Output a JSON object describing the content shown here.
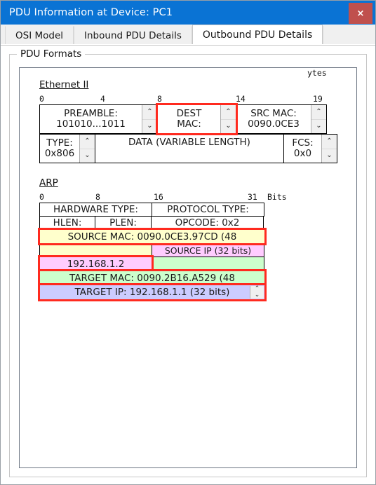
{
  "window": {
    "title": "PDU Information at Device: PC1",
    "close_label": "×",
    "titlebar_color": "#0a73d4",
    "close_color": "#c0504d"
  },
  "tabs": [
    {
      "label": "OSI Model",
      "active": false
    },
    {
      "label": "Inbound PDU Details",
      "active": false
    },
    {
      "label": "Outbound PDU Details",
      "active": true
    }
  ],
  "groupbox": {
    "title": "PDU Formats"
  },
  "ethernet": {
    "heading": "Ethernet II",
    "ruler": [
      "0",
      "4",
      "8",
      "14",
      "19"
    ],
    "unit": "ytes",
    "row1": [
      {
        "name": "preamble",
        "lines": [
          "PREAMBLE:",
          "101010...1011"
        ],
        "spinner": true,
        "highlight": false
      },
      {
        "name": "dest-mac",
        "lines": [
          "DEST",
          "MAC:"
        ],
        "spinner": true,
        "highlight": true
      },
      {
        "name": "src-mac",
        "lines": [
          "SRC MAC:",
          "0090.0CE3"
        ],
        "spinner": true,
        "highlight": false
      }
    ],
    "row2": [
      {
        "name": "type",
        "lines": [
          "TYPE:",
          "0x806"
        ],
        "spinner": true,
        "highlight": false
      },
      {
        "name": "data",
        "lines": [
          "DATA (VARIABLE LENGTH)"
        ],
        "spinner": false,
        "highlight": false
      },
      {
        "name": "fcs",
        "lines": [
          "FCS:",
          "0x0"
        ],
        "spinner": true,
        "highlight": false
      }
    ]
  },
  "arp": {
    "heading": "ARP",
    "ruler": [
      "0",
      "8",
      "16",
      "31"
    ],
    "unit": "Bits",
    "rows": [
      {
        "cells": [
          {
            "name": "hardware-type",
            "text": "HARDWARE TYPE:",
            "color": "#ffffff",
            "highlight": false
          },
          {
            "name": "protocol-type",
            "text": "PROTOCOL TYPE:",
            "color": "#ffffff",
            "highlight": false
          }
        ]
      },
      {
        "cells": [
          {
            "name": "hlen",
            "text": "HLEN:",
            "color": "#ffffff",
            "highlight": false
          },
          {
            "name": "plen",
            "text": "PLEN:",
            "color": "#ffffff",
            "highlight": false
          },
          {
            "name": "opcode",
            "text": "OPCODE: 0x2",
            "color": "#ffffff",
            "highlight": false
          }
        ]
      },
      {
        "cells": [
          {
            "name": "source-mac",
            "text": "SOURCE MAC: 0090.0CE3.97CD (48",
            "color": "#ffffcc",
            "highlight": true
          }
        ]
      },
      {
        "cells": [
          {
            "name": "source-mac-cont",
            "text": "",
            "color": "#ffffcc",
            "highlight": false
          },
          {
            "name": "source-ip-label",
            "text": "SOURCE IP (32 bits)",
            "color": "#ffccff",
            "highlight": false
          }
        ]
      },
      {
        "cells": [
          {
            "name": "source-ip-value",
            "text": "192.168.1.2",
            "color": "#ffccff",
            "highlight": true
          },
          {
            "name": "source-ip-cont",
            "text": "",
            "color": "#ccffcc",
            "highlight": false
          }
        ]
      },
      {
        "cells": [
          {
            "name": "target-mac",
            "text": "TARGET MAC: 0090.2B16.A529 (48",
            "color": "#ccffcc",
            "highlight": true
          }
        ]
      },
      {
        "cells": [
          {
            "name": "target-ip",
            "text": "TARGET IP: 192.168.1.1 (32 bits)",
            "color": "#ccccff",
            "highlight": true,
            "scrollbar": true
          }
        ]
      }
    ]
  },
  "icons": {
    "up_arrow": "⌃",
    "down_arrow": "⌄"
  }
}
